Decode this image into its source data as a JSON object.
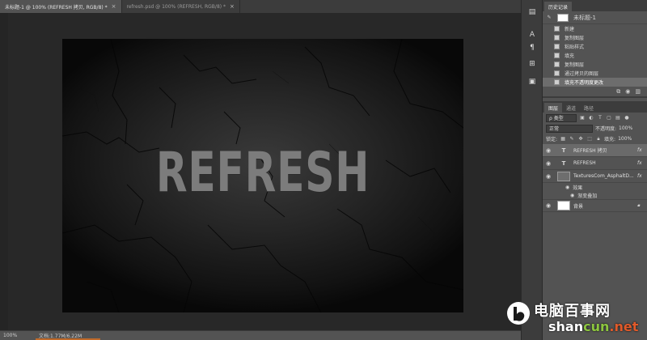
{
  "tabs": [
    {
      "label": "未标题-1 @ 100% (REFRESH 拷贝, RGB/8) *",
      "close": "×",
      "active": true
    },
    {
      "label": "refresh.psd @ 100% (REFRESH, RGB/8) *",
      "close": "×",
      "active": false
    }
  ],
  "canvas": {
    "text": "REFRESH",
    "colors": {
      "text": "#7c7c7c",
      "bg_center": "#3a3a3a",
      "bg_edge": "#080808"
    }
  },
  "status": {
    "zoom": "100%",
    "doc": "文档:1.77M/6.22M"
  },
  "tools": [
    "history-icon",
    "text-icon",
    "paragraph-icon",
    "adjust-icon",
    "image-icon"
  ],
  "history": {
    "tab": "历史记录",
    "snapshot": "未标题-1",
    "items": [
      "新建",
      "复制图层",
      "粘贴样式",
      "填充",
      "复制图层",
      "通过拷贝的图层",
      "填充不透明度更改"
    ]
  },
  "layers_panel": {
    "tabs": [
      "图层",
      "通道",
      "路径"
    ],
    "filter": "ρ 类型",
    "blend_mode": "正常",
    "opacity_label": "不透明度:",
    "opacity": "100%",
    "lock_label": "锁定:",
    "fill_label": "填充:",
    "fill": "100%",
    "layers": [
      {
        "name": "REFRESH 拷贝",
        "type": "T",
        "fx": "fx",
        "selected": true
      },
      {
        "name": "REFRESH",
        "type": "T",
        "fx": "fx",
        "selected": false
      },
      {
        "name": "TexturesCom_AsphaltD...",
        "type": "img",
        "fx": "fx",
        "selected": false
      },
      {
        "name": "背景",
        "type": "bg",
        "fx": "",
        "selected": false
      }
    ],
    "effects_label": "效果",
    "effect_item": "渐变叠加"
  },
  "watermark": {
    "cn": "电脑百事网",
    "en_a": "shan",
    "en_b": "cun",
    "en_c": ".net"
  }
}
